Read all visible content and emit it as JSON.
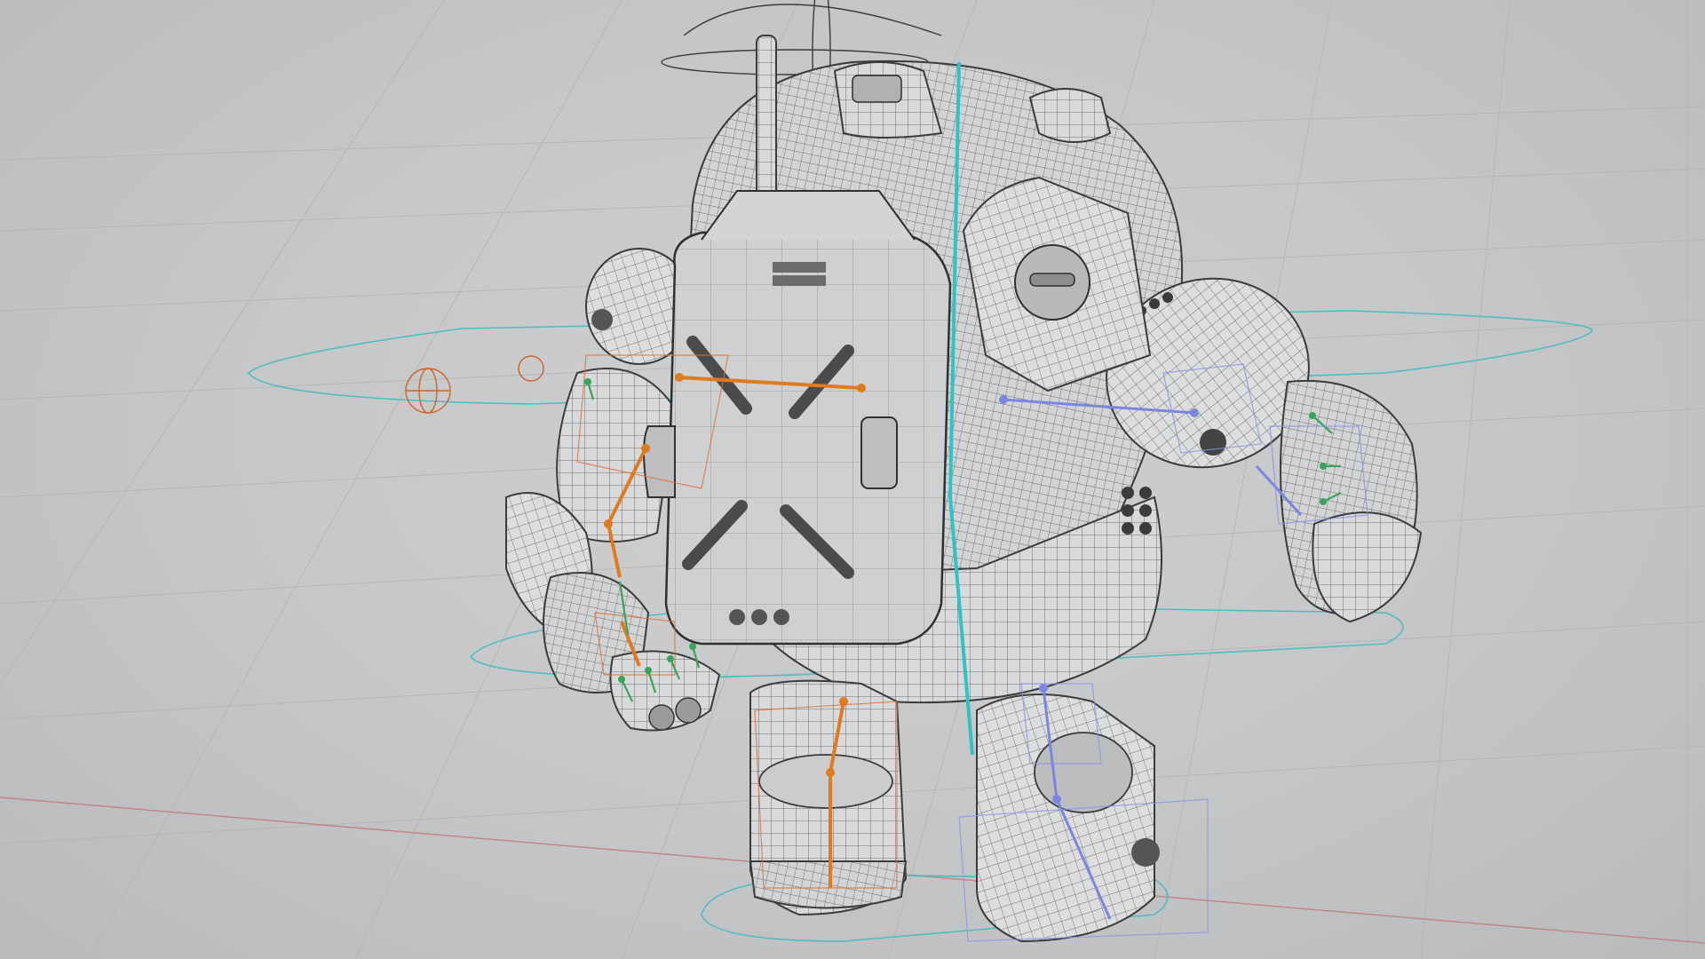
{
  "viewport": {
    "mode": "wireframe-on-shaded",
    "colors": {
      "background": "#c4c5c6",
      "grid": "#b3b4b5",
      "mesh_fill": "#d9dadb",
      "mesh_wire": "#4a4b4c",
      "rig_left": "#e07a1f",
      "rig_right": "#7a86e0",
      "rig_center": "#2fc4c4",
      "fingers": "#3aa35a",
      "axis_x": "#c06b6b"
    }
  },
  "scene": {
    "object": "robot-character",
    "rig": {
      "left_arm_joints": 5,
      "right_arm_joints": 5,
      "finger_joints": 6
    }
  }
}
